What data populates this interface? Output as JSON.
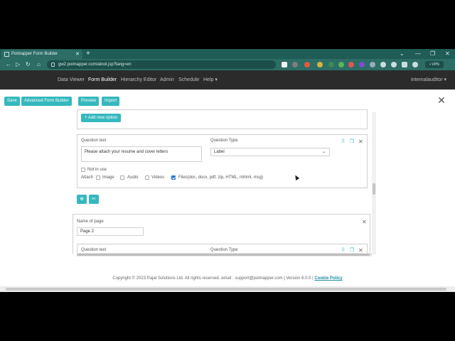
{
  "browser": {
    "tab_title": "Poimapper Form Builder",
    "new_tab": "+",
    "url": "gw2.poimapper.com/atool.jsp?lang=en",
    "vpn_label": "• VPN",
    "window_controls": [
      "⌄",
      "—",
      "❐",
      "✕"
    ]
  },
  "nav": {
    "items": [
      "Data Viewer",
      "Form Builder",
      "Hierarchy Editor",
      "Admin",
      "Schedule",
      "Help ▾"
    ],
    "active_index": 1,
    "user": "internalauditor ▾"
  },
  "toolbar": {
    "save": "Save",
    "advanced": "Advanced Form Builder",
    "preview": "Preview",
    "import": "Import"
  },
  "form": {
    "add_option": "+ Add new option",
    "question_text_label": "Question text",
    "question_text_value": "Please attach your resume and cover letters",
    "question_type_label": "Question Type",
    "question_type_value": "Label",
    "not_in_use": "Not in use",
    "attach_label": "Attach",
    "attach_options": [
      {
        "label": "Image",
        "checked": false
      },
      {
        "label": "Audio",
        "checked": false
      },
      {
        "label": "Videos",
        "checked": false
      },
      {
        "label": "Files(doc, docx, pdf, zip, HTML, mhtml, msg)",
        "checked": true
      }
    ],
    "page_name_label": "Name of page",
    "page_name_value": "Page 2",
    "question_text_label_2": "Question text",
    "question_type_label_2": "Question Type"
  },
  "footer": {
    "text": "Copyright © 2023 Pajat Solutions Ltd. All rights reserved. email : support@poimapper.com | Version 6.0.0 |",
    "cookie_link": "Cookie Policy"
  },
  "colors": {
    "accent": "#35b8be",
    "nav_bg": "#2b2b2b",
    "chrome": "#2c6d66"
  }
}
